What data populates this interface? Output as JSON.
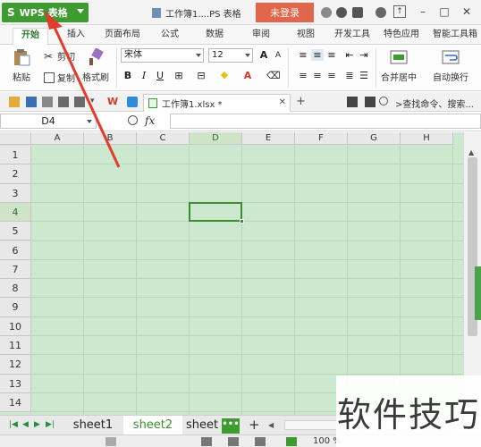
{
  "titlebar": {
    "app_button": "WPS 表格",
    "app_logo": "S",
    "doc_title": "工作簿1....PS 表格",
    "login": "未登录",
    "icons": [
      "hanger-icon",
      "skin-icon",
      "dropdown-d-icon",
      "help-icon",
      "pin-icon",
      "minimize-icon",
      "maximize-icon",
      "close-icon"
    ]
  },
  "ribbon_tabs": [
    "开始",
    "插入",
    "页面布局",
    "公式",
    "数据",
    "审阅",
    "视图",
    "开发工具",
    "特色应用",
    "智能工具箱"
  ],
  "ribbon": {
    "paste": "粘贴",
    "cut": "剪切",
    "copy": "复制",
    "format_painter": "格式刷",
    "font_name": "宋体",
    "font_size": "12",
    "bold": "B",
    "italic": "I",
    "underline": "U",
    "font_grow": "A",
    "font_shrink": "A",
    "merge_center": "合并居中",
    "wrap": "自动换行"
  },
  "qat": {
    "doc_tab": "工作簿1.xlsx *",
    "search_cmd": ">查找命令、搜索..."
  },
  "formula_bar": {
    "name_box": "D4",
    "fx": "fx"
  },
  "grid": {
    "columns": [
      "A",
      "B",
      "C",
      "D",
      "E",
      "F",
      "G",
      "H"
    ],
    "rows": [
      "1",
      "2",
      "3",
      "4",
      "5",
      "6",
      "7",
      "8",
      "9",
      "10",
      "11",
      "12",
      "13",
      "14"
    ],
    "active_cell": "D4",
    "selected_col": "D",
    "selected_row": "4",
    "fill_color": "#cce8cf"
  },
  "sheets": {
    "tabs": [
      "sheet1",
      "sheet2",
      "sheet"
    ],
    "active": "sheet2",
    "more": "•••",
    "add": "+"
  },
  "statusbar": {
    "zoom": "100 %"
  },
  "watermark": "软件技巧",
  "colors": {
    "accent_green": "#3e9b2f",
    "login_orange": "#e2664b",
    "annotation_red": "#e53b2c"
  }
}
